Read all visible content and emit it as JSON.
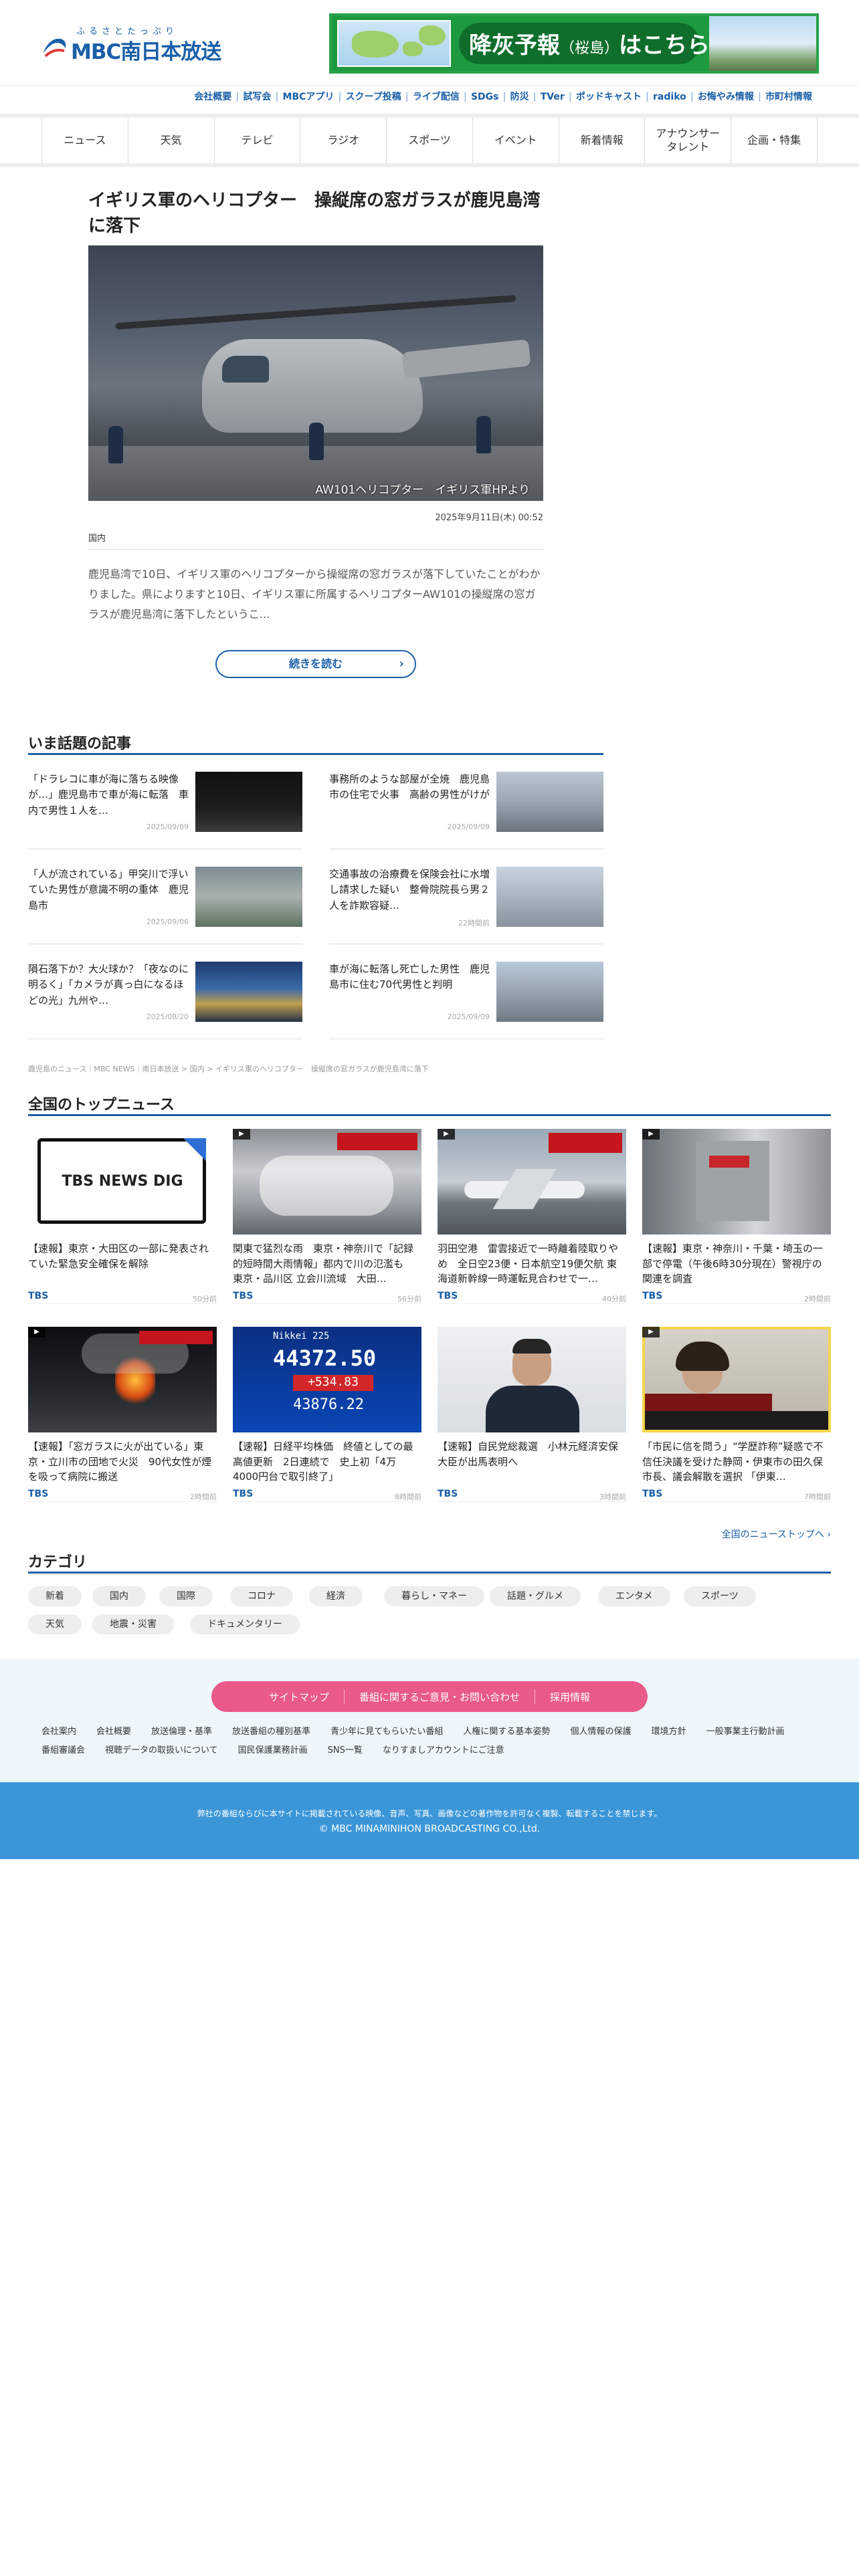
{
  "header": {
    "logo_kana": "ふるさとたっぷり",
    "logo_text": "MBC南日本放送",
    "banner_main": "降灰予報",
    "banner_sub": "（桜島）",
    "banner_tail": "はこちら"
  },
  "topnav": [
    "会社概要",
    "試写会",
    "MBCアプリ",
    "スクープ投稿",
    "ライブ配信",
    "SDGs",
    "防災",
    "TVer",
    "ポッドキャスト",
    "radiko",
    "お悔やみ情報",
    "市町村情報"
  ],
  "gnav": [
    "ニュース",
    "天気",
    "テレビ",
    "ラジオ",
    "スポーツ",
    "イベント",
    "新着情報",
    "アナウンサー\nタレント",
    "企画・特集"
  ],
  "article": {
    "title": "イギリス軍のヘリコプター　操縦席の窓ガラスが鹿児島湾に落下",
    "image_caption": "AW101ヘリコプター　イギリス軍HPより",
    "date": "2025年9月11日(木) 00:52",
    "category": "国内",
    "summary": "鹿児島湾で10日、イギリス軍のヘリコプターから操縦席の窓ガラスが落下していたことがわかりました。県によりますと10日、イギリス軍に所属するヘリコプターAW101の操縦席の窓ガラスが鹿児島湾に落下したというこ…",
    "readmore": "続きを読む"
  },
  "trending": {
    "title": "いま話題の記事",
    "items": [
      {
        "text": "「ドラレコに車が海に落ちる映像が…」鹿児島市で車が海に転落　車内で男性１人を…",
        "date": "2025/09/09"
      },
      {
        "text": "事務所のような部屋が全焼　鹿児島市の住宅で火事　高齢の男性がけが",
        "date": "2025/09/09"
      },
      {
        "text": "「人が流されている」甲突川で浮いていた男性が意識不明の重体　鹿児島市",
        "date": "2025/09/06"
      },
      {
        "text": "交通事故の治療費を保険会社に水増し請求した疑い　整骨院院長ら男２人を詐欺容疑…",
        "date": "22時間前"
      },
      {
        "text": "隕石落下か？大火球か？「夜なのに明るく」「カメラが真っ白になるほどの光」九州や…",
        "date": "2025/08/20"
      },
      {
        "text": "車が海に転落し死亡した男性　鹿児島市に住む70代男性と判明",
        "date": "2025/09/09"
      }
    ]
  },
  "breadcrumb": "鹿児島のニュース｜MBC NEWS｜南日本放送 > 国内 > イギリス軍のヘリコプター　操縦席の窓ガラスが鹿児島湾に落下",
  "topnews": {
    "title": "全国のトップニュース",
    "more": "全国のニューストップへ",
    "logo_text": "TBS NEWS DIG",
    "ticker_label": "Nikkei 225",
    "ticker_value": "44372.50",
    "ticker_change": "+534.83",
    "ticker_prev": "43876.22",
    "items": [
      {
        "title": "【速報】東京・大田区の一部に発表されていた緊急安全確保を解除",
        "source": "TBS",
        "time": "50分前"
      },
      {
        "title": "関東で猛烈な雨　東京・神奈川で「記録的短時間大雨情報」都内で川の氾濫も　東京・品川区 立会川流域　大田…",
        "source": "TBS",
        "time": "56分前"
      },
      {
        "title": "羽田空港　雷雲接近で一時離着陸取りやめ　全日空23便・日本航空19便欠航 東海道新幹線一時運転見合わせで一…",
        "source": "TBS",
        "time": "40分前"
      },
      {
        "title": "【速報】東京・神奈川・千葉・埼玉の一部で停電（午後6時30分現在）警視庁の関連を調査",
        "source": "TBS",
        "time": "2時間前"
      },
      {
        "title": "【速報】「窓ガラスに火が出ている」東京・立川市の団地で火災　90代女性が煙を吸って病院に搬送",
        "source": "TBS",
        "time": "2時間前"
      },
      {
        "title": "【速報】日経平均株価　終値としての最高値更新　2日連続で　史上初「4万4000円台で取引終了」",
        "source": "TBS",
        "time": "8時間前"
      },
      {
        "title": "【速報】自民党総裁選　小林元経済安保大臣が出馬表明へ",
        "source": "TBS",
        "time": "3時間前"
      },
      {
        "title": "「市民に信を問う」“学歴詐称”疑惑で不信任決議を受けた静岡・伊東市の田久保市長、議会解散を選択 「伊東…",
        "source": "TBS",
        "time": "7時間前"
      }
    ]
  },
  "categories": {
    "title": "カテゴリ",
    "items": [
      "新着",
      "国内",
      "国際",
      "コロナ",
      "経済",
      "暮らし・マネー",
      "話題・グルメ",
      "エンタメ",
      "スポーツ",
      "天気",
      "地震・災害",
      "ドキュメンタリー"
    ]
  },
  "footer": {
    "pink": [
      "サイトマップ",
      "番組に関するご意見・お問い合わせ",
      "採用情報"
    ],
    "links": [
      "会社案内",
      "会社概要",
      "放送倫理・基準",
      "放送番組の種別基準",
      "青少年に見てもらいたい番組",
      "人権に関する基本姿勢",
      "個人情報の保護",
      "環境方針",
      "一般事業主行動計画",
      "番組審議会",
      "視聴データの取扱いについて",
      "国民保護業務計画",
      "SNS一覧",
      "なりすましアカウントにご注意"
    ],
    "note": "弊社の番組ならびに本サイトに掲載されている映像、音声、写真、画像などの著作物を許可なく複製、転載することを禁じます。",
    "copyright": "© MBC MINAMINIHON BROADCASTING CO.,Ltd."
  },
  "colors": {
    "brand": "#1a5fa8",
    "banner_green": "#1d9a3f",
    "pink": "#e9598a",
    "footer_blue": "#3b96d8"
  }
}
